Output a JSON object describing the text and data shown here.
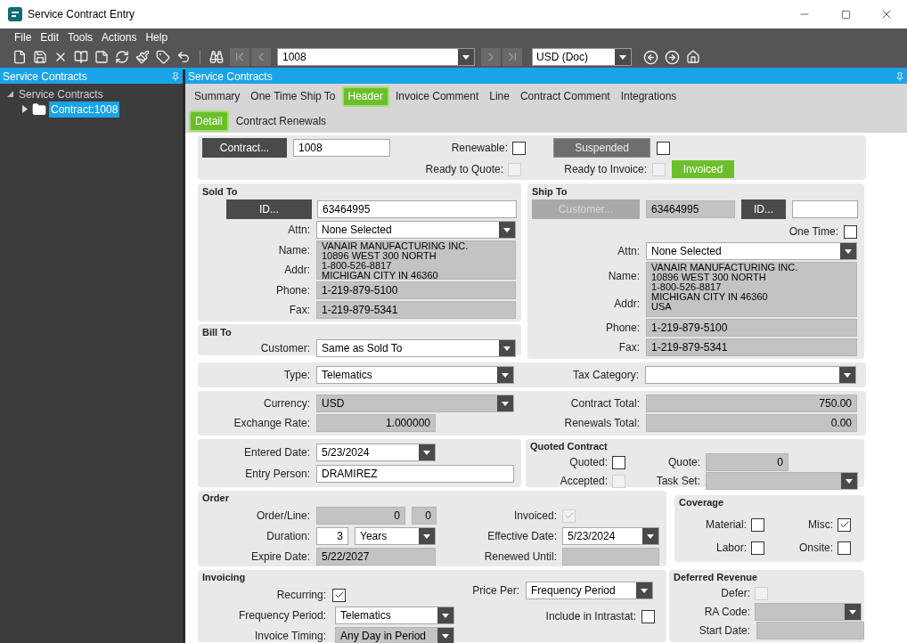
{
  "window": {
    "title": "Service Contract Entry"
  },
  "menu": [
    "File",
    "Edit",
    "Tools",
    "Actions",
    "Help"
  ],
  "toolbar": {
    "record": "1008",
    "currency": "USD (Doc)"
  },
  "tree": {
    "title": "Service Contracts",
    "items": [
      {
        "label": "Service Contracts",
        "selected": false,
        "expanded": true,
        "children": [
          {
            "label": "Contract:1008",
            "selected": true,
            "expanded": false
          }
        ]
      }
    ]
  },
  "panel_title": "Service Contracts",
  "tabs": [
    {
      "label": "Summary",
      "selected": false
    },
    {
      "label": "One Time Ship To",
      "selected": false
    },
    {
      "label": "Header",
      "selected": true
    },
    {
      "label": "Invoice Comment",
      "selected": false
    },
    {
      "label": "Line",
      "selected": false
    },
    {
      "label": "Contract Comment",
      "selected": false
    },
    {
      "label": "Integrations",
      "selected": false
    }
  ],
  "subtabs": [
    {
      "label": "Detail",
      "selected": true
    },
    {
      "label": "Contract Renewals",
      "selected": false
    }
  ],
  "contract": {
    "button": {
      "kind": "button",
      "label": "Contract...",
      "disabled": false
    },
    "id": {
      "kind": "text",
      "value": "1008"
    },
    "renewable": {
      "label": "Renewable:",
      "control": {
        "kind": "check",
        "checked": false,
        "disabled": false
      }
    },
    "ready_to_quote": {
      "label": "Ready to Quote:",
      "control": {
        "kind": "check",
        "checked": false,
        "disabled": true
      }
    },
    "suspended": {
      "kind": "toggle",
      "label": "Suspended",
      "disabled": false
    },
    "suspended_check": {
      "kind": "check",
      "checked": false,
      "disabled": false
    },
    "ready_to_invoice": {
      "label": "Ready to Invoice:",
      "control": {
        "kind": "check",
        "checked": false,
        "disabled": true
      }
    },
    "status": "Invoiced"
  },
  "sold_to": {
    "title": "Sold To",
    "id_button": {
      "kind": "button",
      "label": "ID...",
      "disabled": false
    },
    "id": {
      "kind": "text",
      "value": "63464995"
    },
    "attn": {
      "label": "Attn:",
      "control": {
        "kind": "combo",
        "value": "None Selected",
        "disabled": false
      }
    },
    "address": {
      "labels": [
        "Name:",
        "Addr:"
      ],
      "lines": [
        "VANAIR MANUFACTURING INC.",
        "10896 WEST 300 NORTH",
        "1-800-526-8817",
        "MICHIGAN CITY IN 46360"
      ]
    },
    "phone": {
      "label": "Phone:",
      "control": {
        "kind": "readonly",
        "value": "1-219-879-5100"
      }
    },
    "fax": {
      "label": "Fax:",
      "control": {
        "kind": "readonly",
        "value": "1-219-879-5341"
      }
    }
  },
  "bill_to": {
    "title": "Bill To",
    "customer": {
      "label": "Customer:",
      "control": {
        "kind": "combo",
        "value": "Same as Sold To",
        "disabled": false
      }
    }
  },
  "ship_to": {
    "title": "Ship To",
    "customer_button": {
      "kind": "button",
      "label": "Customer...",
      "disabled": true
    },
    "customer": {
      "kind": "readonly",
      "value": "63464995"
    },
    "id_button": {
      "kind": "button",
      "label": "ID...",
      "disabled": false
    },
    "id": {
      "kind": "text"
    },
    "one_time": {
      "label": "One Time:",
      "control": {
        "kind": "check",
        "checked": false,
        "disabled": false
      }
    },
    "attn": {
      "label": "Attn:",
      "control": {
        "kind": "combo",
        "value": "None Selected",
        "disabled": false
      }
    },
    "address": {
      "labels": [
        "Name:",
        "Addr:"
      ],
      "lines": [
        "VANAIR MANUFACTURING INC.",
        "10896 WEST 300 NORTH",
        "1-800-526-8817",
        "MICHIGAN CITY IN 46360",
        "USA"
      ]
    },
    "phone": {
      "label": "Phone:",
      "control": {
        "kind": "readonly",
        "value": "1-219-879-5100"
      }
    },
    "fax": {
      "label": "Fax:",
      "control": {
        "kind": "readonly",
        "value": "1-219-879-5341"
      }
    }
  },
  "type": {
    "label": "Type:",
    "control": {
      "kind": "combo",
      "value": "Telematics",
      "disabled": false
    }
  },
  "tax_category": {
    "label": "Tax Category:",
    "control": {
      "kind": "combo",
      "disabled": false
    }
  },
  "currency": {
    "label": "Currency:",
    "control": {
      "kind": "combo",
      "value": "USD",
      "disabled": true
    }
  },
  "exchange_rate": {
    "label": "Exchange Rate:",
    "control": {
      "kind": "readonly",
      "value": "1.000000"
    }
  },
  "contract_total": {
    "label": "Contract Total:",
    "control": {
      "kind": "readonly",
      "value": "750.00"
    }
  },
  "renewals_total": {
    "label": "Renewals Total:",
    "control": {
      "kind": "readonly",
      "value": "0.00"
    }
  },
  "entered_date": {
    "label": "Entered Date:",
    "control": {
      "kind": "combo",
      "value": "5/23/2024",
      "disabled": false
    }
  },
  "entry_person": {
    "label": "Entry Person:",
    "control": {
      "kind": "text",
      "value": "DRAMIREZ"
    }
  },
  "quoted_contract": {
    "title": "Quoted Contract",
    "quoted": {
      "label": "Quoted:",
      "control": {
        "kind": "check",
        "checked": false,
        "disabled": false
      }
    },
    "quote": {
      "label": "Quote:",
      "control": {
        "kind": "readonly",
        "value": "0"
      }
    },
    "accepted": {
      "label": "Accepted:",
      "control": {
        "kind": "check",
        "checked": false,
        "disabled": true
      }
    },
    "task_set": {
      "label": "Task Set:",
      "control": {
        "kind": "combo",
        "disabled": true
      }
    }
  },
  "order": {
    "title": "Order",
    "order_line": {
      "label": "Order/Line:",
      "order": {
        "kind": "readonly",
        "value": "0"
      },
      "line": {
        "kind": "readonly",
        "value": "0"
      }
    },
    "duration": {
      "label": "Duration:",
      "count": {
        "kind": "text",
        "value": "3"
      },
      "unit": {
        "kind": "combo",
        "value": "Years",
        "disabled": false
      }
    },
    "expire_date": {
      "label": "Expire Date:",
      "control": {
        "kind": "readonly",
        "value": "5/22/2027"
      }
    },
    "invoiced": {
      "label": "Invoiced:",
      "control": {
        "kind": "check",
        "checked": true,
        "disabled": true
      }
    },
    "effective_date": {
      "label": "Effective Date:",
      "control": {
        "kind": "combo",
        "value": "5/23/2024",
        "disabled": false
      }
    },
    "renewed_until": {
      "label": "Renewed Until:",
      "control": {
        "kind": "readonly"
      }
    }
  },
  "coverage": {
    "title": "Coverage",
    "items": [
      {
        "label": "Material:",
        "control": {
          "kind": "check",
          "checked": false,
          "disabled": false
        }
      },
      {
        "label": "Misc:",
        "control": {
          "kind": "check",
          "checked": true,
          "disabled": false
        }
      },
      {
        "label": "Labor:",
        "control": {
          "kind": "check",
          "checked": false,
          "disabled": false
        }
      },
      {
        "label": "Onsite:",
        "control": {
          "kind": "check",
          "checked": false,
          "disabled": false
        }
      }
    ]
  },
  "invoicing": {
    "title": "Invoicing",
    "recurring": {
      "label": "Recurring:",
      "control": {
        "kind": "check",
        "checked": true,
        "disabled": false
      }
    },
    "frequency_period": {
      "label": "Frequency Period:",
      "control": {
        "kind": "combo",
        "value": "Telematics",
        "disabled": false
      }
    },
    "invoice_timing": {
      "label": "Invoice Timing:",
      "control": {
        "kind": "combo",
        "value": "Any Day in Period",
        "disabled": true
      }
    },
    "price_per": {
      "label": "Price Per:",
      "control": {
        "kind": "combo",
        "value": "Frequency Period",
        "disabled": false
      }
    },
    "intrastat": {
      "label": "Include in Intrastat:",
      "control": {
        "kind": "check",
        "checked": false,
        "disabled": false
      }
    }
  },
  "deferred_revenue": {
    "title": "Deferred Revenue",
    "defer": {
      "label": "Defer:",
      "control": {
        "kind": "check",
        "checked": false,
        "disabled": true
      }
    },
    "ra_code": {
      "label": "RA Code:",
      "control": {
        "kind": "combo",
        "disabled": true
      }
    },
    "start_date": {
      "label": "Start Date:",
      "control": {
        "kind": "readonly"
      }
    }
  }
}
